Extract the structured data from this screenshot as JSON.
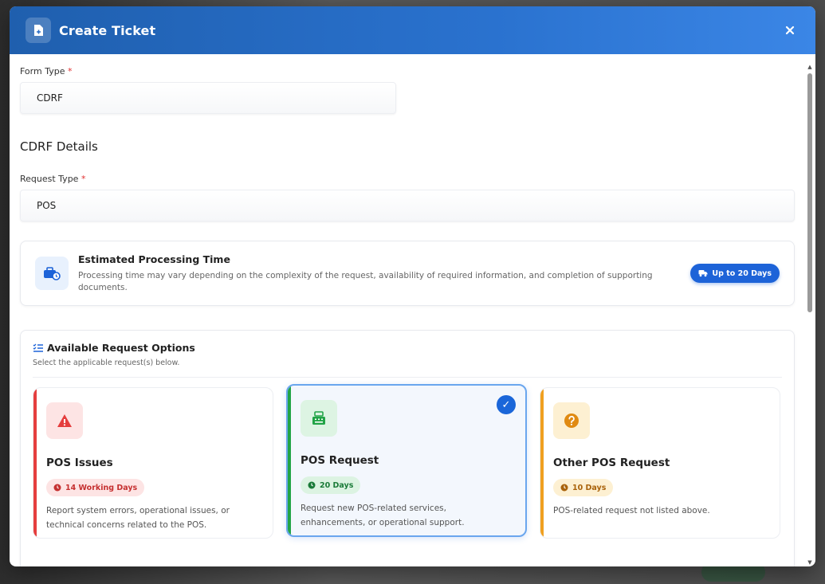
{
  "modal": {
    "title": "Create Ticket",
    "close_icon": "close-icon"
  },
  "form_type": {
    "label": "Form Type",
    "required_mark": "*",
    "value": "CDRF"
  },
  "section_title": "CDRF Details",
  "request_type": {
    "label": "Request Type",
    "required_mark": "*",
    "value": "POS"
  },
  "processing": {
    "title": "Estimated Processing Time",
    "description": "Processing time may vary depending on the complexity of the request, availability of required information, and completion of supporting documents.",
    "badge": "Up to 20 Days",
    "badge_color": "#1d63d8"
  },
  "options": {
    "title": "Available Request Options",
    "subtitle": "Select the applicable request(s) below.",
    "cards": [
      {
        "title": "POS Issues",
        "badge": "14 Working Days",
        "description": "Report system errors, operational issues, or technical concerns related to the POS.",
        "accent": "#e53e3e",
        "selected": false
      },
      {
        "title": "POS Request",
        "badge": "20 Days",
        "description": "Request new POS-related services, enhancements, or operational support.",
        "accent": "#22a447",
        "selected": true
      },
      {
        "title": "Other POS Request",
        "badge": "10 Days",
        "description": "POS-related request not listed above.",
        "accent": "#f0a020",
        "selected": false
      }
    ]
  },
  "check_mark": "✓"
}
